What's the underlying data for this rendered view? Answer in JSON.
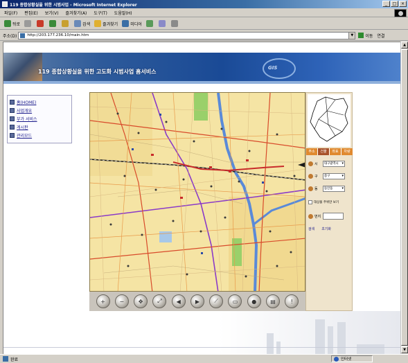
{
  "window": {
    "title": "119 종합상황실을 위한 시범사업 - Microsoft Internet Explorer",
    "controls": [
      "_",
      "□",
      "×"
    ]
  },
  "menu": [
    "파일(F)",
    "편집(E)",
    "보기(V)",
    "즐겨찾기(A)",
    "도구(T)",
    "도움말(H)"
  ],
  "toolbar": {
    "back": "뒤로",
    "search": "검색",
    "favorites": "즐겨찾기",
    "history": "미디어"
  },
  "address": {
    "label": "주소(D)",
    "url": "http://203.177.236.10/main.htm",
    "go": "이동",
    "links": "연결"
  },
  "banner": {
    "title": "119 종합상황실을 위한 고도화 시범사업 홈서비스",
    "logo": "GIS"
  },
  "leftmenu": [
    {
      "label": "홈(HOME)"
    },
    {
      "label": "사업개요"
    },
    {
      "label": "부가 서비스"
    },
    {
      "label": "게시판"
    },
    {
      "label": "관리모드"
    }
  ],
  "maptools": [
    "zoom-in",
    "zoom-out",
    "pan",
    "full-extent",
    "previous",
    "next",
    "measure",
    "area",
    "info",
    "print",
    "help"
  ],
  "rightpanel": {
    "tabs": [
      "주소",
      "건물",
      "좌표",
      "차량"
    ],
    "rows": [
      {
        "label": "시",
        "value": "대구광역시"
      },
      {
        "label": "구",
        "value": "중구"
      },
      {
        "label": "동",
        "value": "동인동"
      }
    ],
    "checkbox_label": "대상물 주위만 보기",
    "search_label": "번지",
    "links": [
      "검색",
      "초기화"
    ]
  },
  "status": {
    "text": "완료",
    "zone": "인터넷"
  }
}
